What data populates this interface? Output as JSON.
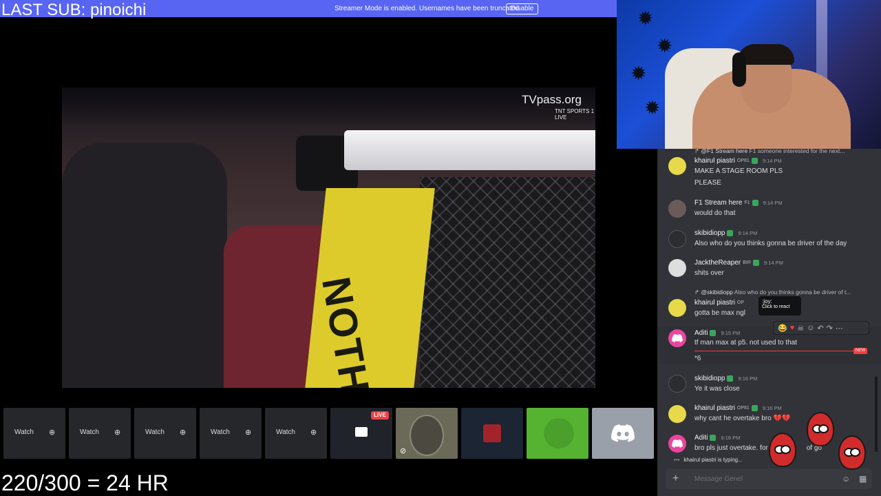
{
  "overlay": {
    "last_sub": "LAST SUB: pinoichi",
    "counter": "220/300 = 24 HR"
  },
  "streamer_banner": {
    "message": "Streamer Mode is enabled. Usernames have been truncated.",
    "button": "Disable"
  },
  "video": {
    "watermark": "TVpass.org",
    "channel": "TNT SPORTS 1 LIVE",
    "post_text": "NOTH"
  },
  "tiles": [
    {
      "watch": "Watch"
    },
    {
      "watch": "Watch"
    },
    {
      "watch": "Watch"
    },
    {
      "watch": "Watch"
    },
    {
      "watch": "Watch"
    }
  ],
  "live_badge": "LIVE",
  "chat": {
    "reply_top": {
      "name": "@F1 Stream here",
      "role": "F1",
      "text": "someone interested for the next..."
    },
    "messages": [
      {
        "name": "khairul piastri",
        "role": "OP81",
        "time": "9:14 PM",
        "lines": [
          "MAKE A STAGE ROOM PLS",
          "PLEASE"
        ]
      },
      {
        "name": "F1 Stream here",
        "role": "F1",
        "time": "9:14 PM",
        "lines": [
          "would do that"
        ]
      },
      {
        "name": "skibidiopp",
        "role": "",
        "time": "9:14 PM",
        "lines": [
          "Also who do you thinks gonna be driver of the day"
        ]
      },
      {
        "name": "JacktheReaper",
        "role": "BIR",
        "time": "9:14 PM",
        "lines": [
          "shits over"
        ]
      },
      {
        "name": "khairul piastri",
        "role": "OP",
        "time": "",
        "lines": [
          "gotta be max ngl"
        ]
      },
      {
        "name": "Aditi",
        "role": "",
        "time": "9:15 PM",
        "lines": [
          "tf man max at p5. not used to that",
          "*6"
        ]
      },
      {
        "name": "skibidiopp",
        "role": "",
        "time": "9:16 PM",
        "lines": [
          "Ye it was close"
        ]
      },
      {
        "name": "khairul piastri",
        "role": "OP81",
        "time": "9:16 PM",
        "lines": [
          "why cant he overtake bro 💔💔"
        ]
      },
      {
        "name": "Aditi",
        "role": "",
        "time": "9:16 PM",
        "lines": [
          "bro pls just overtake. for",
          "of go"
        ]
      }
    ],
    "reply_mid": {
      "name": "@skibidiopp",
      "text": "Also who do you thinks gonna be driver of t..."
    },
    "tooltip": {
      "title": ":joy:",
      "sub": "Click to react"
    },
    "new_badge": "NEW",
    "typing": "khairul piastri is typing...",
    "composer_placeholder": "Message Genel"
  },
  "icons": {
    "zoom": "zoom-icon",
    "discord": "discord-logo-icon",
    "plus": "plus-icon",
    "emoji": "emoji-icon"
  },
  "colors": {
    "banner": "#5865f2",
    "chat_bg": "#313338",
    "live": "#ed4245",
    "online_badge": "#3ba55d"
  }
}
